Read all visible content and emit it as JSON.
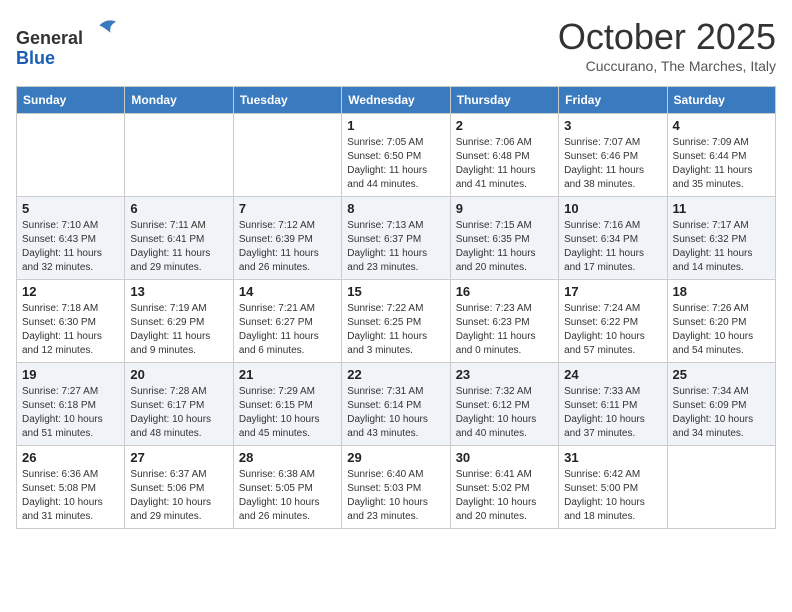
{
  "header": {
    "logo_line1": "General",
    "logo_line2": "Blue",
    "month": "October 2025",
    "location": "Cuccurano, The Marches, Italy"
  },
  "weekdays": [
    "Sunday",
    "Monday",
    "Tuesday",
    "Wednesday",
    "Thursday",
    "Friday",
    "Saturday"
  ],
  "weeks": [
    [
      {
        "day": "",
        "info": ""
      },
      {
        "day": "",
        "info": ""
      },
      {
        "day": "",
        "info": ""
      },
      {
        "day": "1",
        "info": "Sunrise: 7:05 AM\nSunset: 6:50 PM\nDaylight: 11 hours\nand 44 minutes."
      },
      {
        "day": "2",
        "info": "Sunrise: 7:06 AM\nSunset: 6:48 PM\nDaylight: 11 hours\nand 41 minutes."
      },
      {
        "day": "3",
        "info": "Sunrise: 7:07 AM\nSunset: 6:46 PM\nDaylight: 11 hours\nand 38 minutes."
      },
      {
        "day": "4",
        "info": "Sunrise: 7:09 AM\nSunset: 6:44 PM\nDaylight: 11 hours\nand 35 minutes."
      }
    ],
    [
      {
        "day": "5",
        "info": "Sunrise: 7:10 AM\nSunset: 6:43 PM\nDaylight: 11 hours\nand 32 minutes."
      },
      {
        "day": "6",
        "info": "Sunrise: 7:11 AM\nSunset: 6:41 PM\nDaylight: 11 hours\nand 29 minutes."
      },
      {
        "day": "7",
        "info": "Sunrise: 7:12 AM\nSunset: 6:39 PM\nDaylight: 11 hours\nand 26 minutes."
      },
      {
        "day": "8",
        "info": "Sunrise: 7:13 AM\nSunset: 6:37 PM\nDaylight: 11 hours\nand 23 minutes."
      },
      {
        "day": "9",
        "info": "Sunrise: 7:15 AM\nSunset: 6:35 PM\nDaylight: 11 hours\nand 20 minutes."
      },
      {
        "day": "10",
        "info": "Sunrise: 7:16 AM\nSunset: 6:34 PM\nDaylight: 11 hours\nand 17 minutes."
      },
      {
        "day": "11",
        "info": "Sunrise: 7:17 AM\nSunset: 6:32 PM\nDaylight: 11 hours\nand 14 minutes."
      }
    ],
    [
      {
        "day": "12",
        "info": "Sunrise: 7:18 AM\nSunset: 6:30 PM\nDaylight: 11 hours\nand 12 minutes."
      },
      {
        "day": "13",
        "info": "Sunrise: 7:19 AM\nSunset: 6:29 PM\nDaylight: 11 hours\nand 9 minutes."
      },
      {
        "day": "14",
        "info": "Sunrise: 7:21 AM\nSunset: 6:27 PM\nDaylight: 11 hours\nand 6 minutes."
      },
      {
        "day": "15",
        "info": "Sunrise: 7:22 AM\nSunset: 6:25 PM\nDaylight: 11 hours\nand 3 minutes."
      },
      {
        "day": "16",
        "info": "Sunrise: 7:23 AM\nSunset: 6:23 PM\nDaylight: 11 hours\nand 0 minutes."
      },
      {
        "day": "17",
        "info": "Sunrise: 7:24 AM\nSunset: 6:22 PM\nDaylight: 10 hours\nand 57 minutes."
      },
      {
        "day": "18",
        "info": "Sunrise: 7:26 AM\nSunset: 6:20 PM\nDaylight: 10 hours\nand 54 minutes."
      }
    ],
    [
      {
        "day": "19",
        "info": "Sunrise: 7:27 AM\nSunset: 6:18 PM\nDaylight: 10 hours\nand 51 minutes."
      },
      {
        "day": "20",
        "info": "Sunrise: 7:28 AM\nSunset: 6:17 PM\nDaylight: 10 hours\nand 48 minutes."
      },
      {
        "day": "21",
        "info": "Sunrise: 7:29 AM\nSunset: 6:15 PM\nDaylight: 10 hours\nand 45 minutes."
      },
      {
        "day": "22",
        "info": "Sunrise: 7:31 AM\nSunset: 6:14 PM\nDaylight: 10 hours\nand 43 minutes."
      },
      {
        "day": "23",
        "info": "Sunrise: 7:32 AM\nSunset: 6:12 PM\nDaylight: 10 hours\nand 40 minutes."
      },
      {
        "day": "24",
        "info": "Sunrise: 7:33 AM\nSunset: 6:11 PM\nDaylight: 10 hours\nand 37 minutes."
      },
      {
        "day": "25",
        "info": "Sunrise: 7:34 AM\nSunset: 6:09 PM\nDaylight: 10 hours\nand 34 minutes."
      }
    ],
    [
      {
        "day": "26",
        "info": "Sunrise: 6:36 AM\nSunset: 5:08 PM\nDaylight: 10 hours\nand 31 minutes."
      },
      {
        "day": "27",
        "info": "Sunrise: 6:37 AM\nSunset: 5:06 PM\nDaylight: 10 hours\nand 29 minutes."
      },
      {
        "day": "28",
        "info": "Sunrise: 6:38 AM\nSunset: 5:05 PM\nDaylight: 10 hours\nand 26 minutes."
      },
      {
        "day": "29",
        "info": "Sunrise: 6:40 AM\nSunset: 5:03 PM\nDaylight: 10 hours\nand 23 minutes."
      },
      {
        "day": "30",
        "info": "Sunrise: 6:41 AM\nSunset: 5:02 PM\nDaylight: 10 hours\nand 20 minutes."
      },
      {
        "day": "31",
        "info": "Sunrise: 6:42 AM\nSunset: 5:00 PM\nDaylight: 10 hours\nand 18 minutes."
      },
      {
        "day": "",
        "info": ""
      }
    ]
  ]
}
